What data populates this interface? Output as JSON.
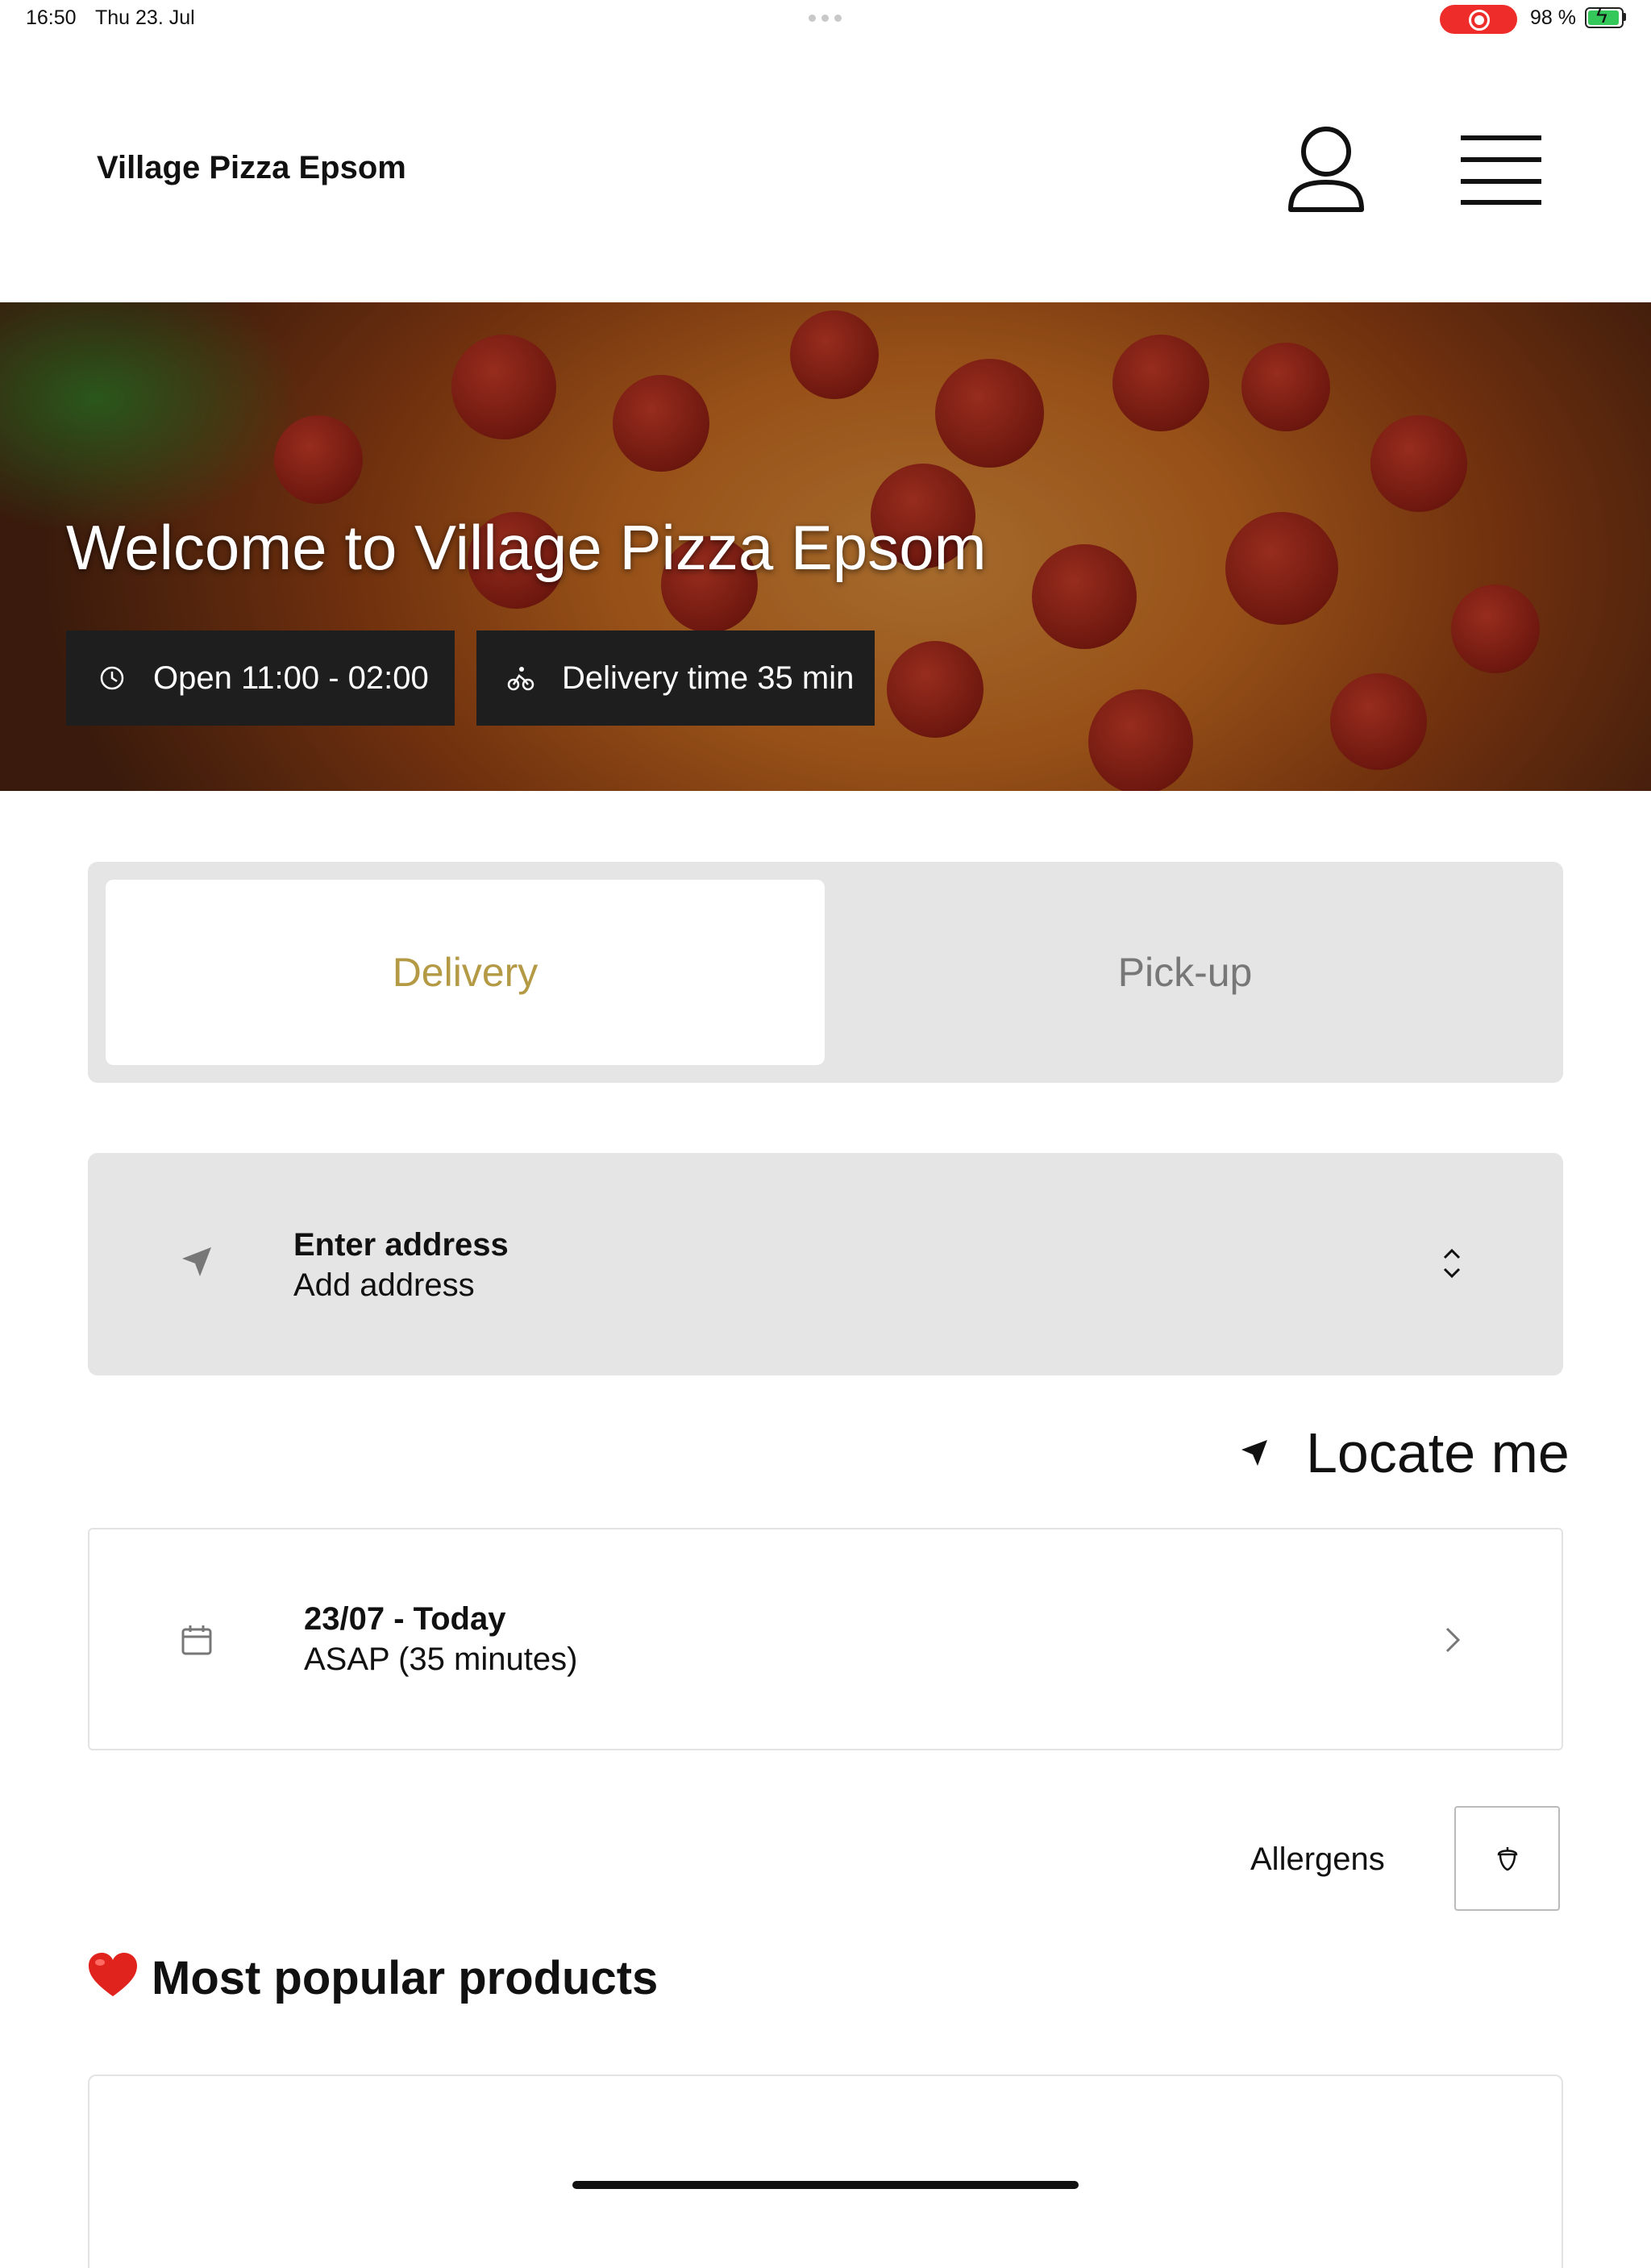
{
  "status_bar": {
    "time": "16:50",
    "date": "Thu 23. Jul",
    "battery": "98 %",
    "battery_level": 0.98,
    "recording_color": "#ee2d2a"
  },
  "header": {
    "title": "Village Pizza Epsom",
    "account_icon": "person-icon",
    "menu_icon": "hamburger-menu-icon"
  },
  "hero": {
    "title": "Welcome to Village Pizza Epsom",
    "opening_hours": "Open 11:00 - 02:00",
    "delivery_time": "Delivery time 35 min"
  },
  "order_type": {
    "tabs": [
      {
        "label": "Delivery",
        "selected": true
      },
      {
        "label": "Pick-up",
        "selected": false
      }
    ],
    "accent_color": "#b49a45"
  },
  "address": {
    "label": "Enter address",
    "value": "Add address"
  },
  "locate": {
    "label": "Locate me"
  },
  "schedule": {
    "date": "23/07 - Today",
    "time": "ASAP (35 minutes)"
  },
  "allergens": {
    "label": "Allergens"
  },
  "popular": {
    "title": "Most popular products"
  }
}
